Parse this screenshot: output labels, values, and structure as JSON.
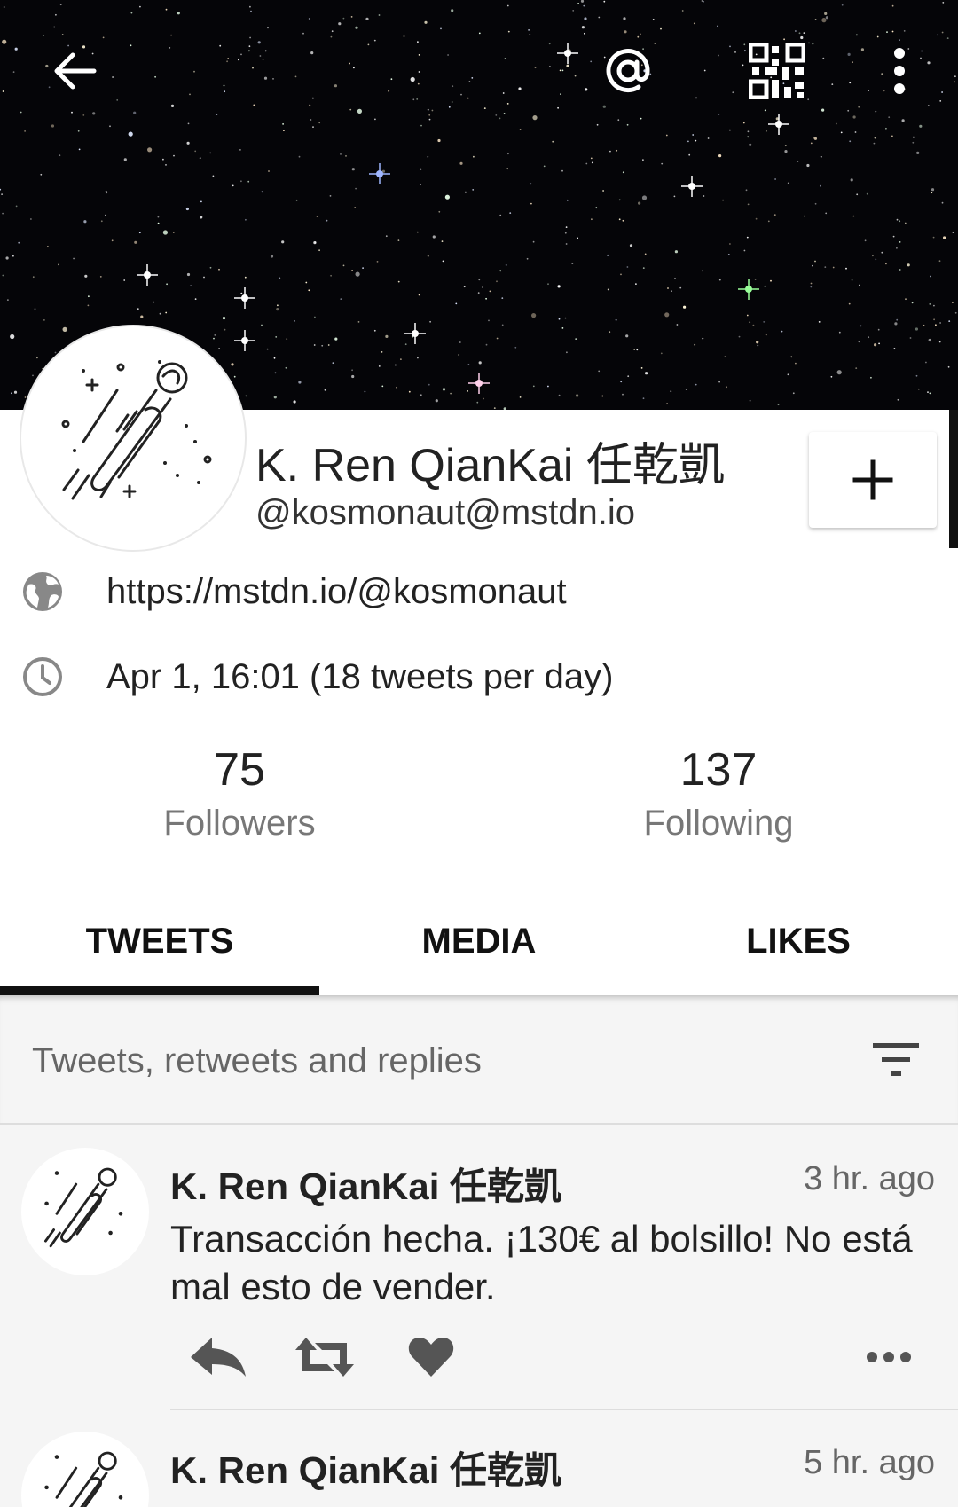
{
  "profile": {
    "display_name": "K. Ren QianKai 任乾凱",
    "handle": "@kosmonaut@mstdn.io",
    "url": "https://mstdn.io/@kosmonaut",
    "joined": "Apr 1, 16:01 (18 tweets per day)"
  },
  "stats": {
    "followers_count": "75",
    "followers_label": "Followers",
    "following_count": "137",
    "following_label": "Following"
  },
  "tabs": [
    {
      "label": "TWEETS",
      "active": true
    },
    {
      "label": "MEDIA",
      "active": false
    },
    {
      "label": "LIKES",
      "active": false
    }
  ],
  "filter": {
    "label": "Tweets, retweets and replies"
  },
  "tweets": [
    {
      "author": "K. Ren QianKai 任乾凱",
      "time": "3 hr. ago",
      "text": "Transacción hecha. ¡130€ al bolsillo! No está mal esto de vender."
    },
    {
      "author": "K. Ren QianKai 任乾凱",
      "time": "5 hr. ago"
    }
  ],
  "icons": {
    "back": "arrow-left-icon",
    "mention": "at-sign-icon",
    "qr": "qr-code-icon",
    "menu": "more-vertical-icon",
    "follow": "plus-icon",
    "url": "globe-icon",
    "joined": "clock-icon",
    "filter": "filter-icon",
    "reply": "reply-icon",
    "retweet": "retweet-icon",
    "like": "heart-icon",
    "more": "more-horizontal-icon"
  },
  "colors": {
    "banner_bg": "#050508",
    "text_primary": "#222222",
    "text_secondary": "#777777",
    "background": "#f5f5f5",
    "tab_indicator": "#111111"
  }
}
